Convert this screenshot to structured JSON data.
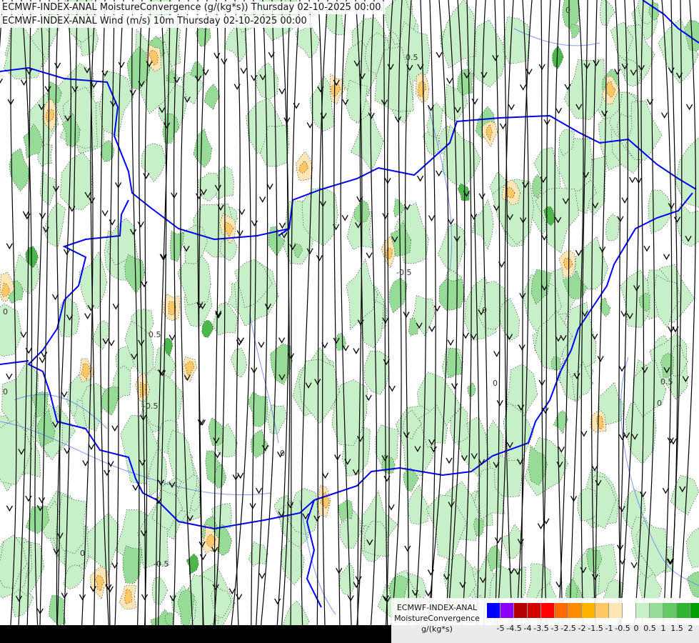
{
  "header": {
    "line1": "ECMWF-INDEX-ANAL MoistureConvergence (g/(kg*s)) Thursday 02-10-2025 00:00",
    "line2": "ECMWF-INDEX-ANAL Wind (m/s) 10m Thursday 02-10-2025 00:00"
  },
  "legend": {
    "title_line1": "ECMWF-INDEX-ANAL",
    "title_line2": "MoistureConvergence",
    "title_line3": "g/(kg*s)",
    "colors": [
      "#0000ff",
      "#8c00ff",
      "#b40000",
      "#d40000",
      "#ff0000",
      "#ff6a00",
      "#ff8c00",
      "#ffb400",
      "#ffc864",
      "#ffe6b4",
      "#ffffff",
      "#c8f0c8",
      "#96dc96",
      "#64c864",
      "#32b432",
      "#00a000"
    ],
    "ticks": [
      "-5",
      "-4.5",
      "-4",
      "-3.5",
      "-3",
      "-2.5",
      "-2",
      "-1.5",
      "-1",
      "-0.5",
      "0",
      "0.5",
      "1",
      "1.5",
      "2"
    ]
  },
  "contour_labels": [
    "0.5",
    "0.5",
    "-0.5",
    "0",
    "-0.5",
    "-0.5",
    "0",
    "0",
    "0.5",
    "0",
    "0",
    "0",
    "0",
    "0"
  ],
  "colors": {
    "border": "#0000ff",
    "river": "#4a6cff",
    "streamline": "#000000",
    "convergence_light": "#c8f0c8",
    "convergence_mid": "#96dc96",
    "convergence_dark": "#4cb84c",
    "divergence_light": "#ffe6b4",
    "divergence_mid": "#ffc864"
  }
}
